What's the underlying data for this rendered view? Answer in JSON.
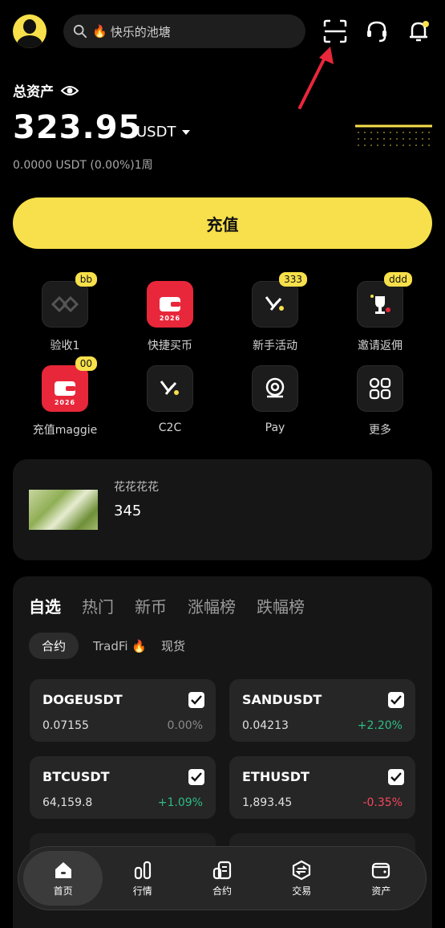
{
  "header": {
    "search_placeholder": "快乐的池塘",
    "icons": [
      "avatar",
      "search-icon",
      "fire-icon",
      "scan-icon",
      "headset-icon",
      "bell-icon"
    ]
  },
  "asset": {
    "label": "总资产",
    "amount": "323.95",
    "unit": "USDT",
    "pnl": "0.0000 USDT (0.00%)1周"
  },
  "recharge_label": "充值",
  "shortcuts": [
    {
      "label": "验收1",
      "badge": "bb",
      "icon": "logo-icon"
    },
    {
      "label": "快捷买币",
      "badge": "",
      "icon": "wallet-2026-icon",
      "year": "2026"
    },
    {
      "label": "新手活动",
      "badge": "333",
      "icon": "rocket-icon"
    },
    {
      "label": "邀请返佣",
      "badge": "ddd",
      "icon": "trophy-icon"
    },
    {
      "label": "充值maggie",
      "badge": "00",
      "icon": "wallet-2026-icon",
      "year": "2026"
    },
    {
      "label": "C2C",
      "badge": "",
      "icon": "rocket-icon"
    },
    {
      "label": "Pay",
      "badge": "",
      "icon": "pay-icon"
    },
    {
      "label": "更多",
      "badge": "",
      "icon": "grid-icon"
    }
  ],
  "card": {
    "title": "花花花花",
    "value": "345"
  },
  "market": {
    "tabs": [
      "自选",
      "热门",
      "新币",
      "涨幅榜",
      "跌幅榜"
    ],
    "subtabs": [
      "合约",
      "TradFi",
      "现货"
    ],
    "coins": [
      {
        "symbol": "DOGEUSDT",
        "price": "0.07155",
        "change": "0.00%",
        "dir": "zero"
      },
      {
        "symbol": "SANDUSDT",
        "price": "0.04213",
        "change": "+2.20%",
        "dir": "up"
      },
      {
        "symbol": "BTCUSDT",
        "price": "64,159.8",
        "change": "+1.09%",
        "dir": "up"
      },
      {
        "symbol": "ETHUSDT",
        "price": "1,893.45",
        "change": "-0.35%",
        "dir": "down"
      }
    ]
  },
  "nav": [
    {
      "label": "首页",
      "active": true
    },
    {
      "label": "行情",
      "active": false
    },
    {
      "label": "合约",
      "active": false
    },
    {
      "label": "交易",
      "active": false
    },
    {
      "label": "资产",
      "active": false
    }
  ],
  "colors": {
    "accent": "#f7e04b",
    "up": "#2ebd85",
    "down": "#f6465d",
    "badge_red": "#e8273a"
  }
}
